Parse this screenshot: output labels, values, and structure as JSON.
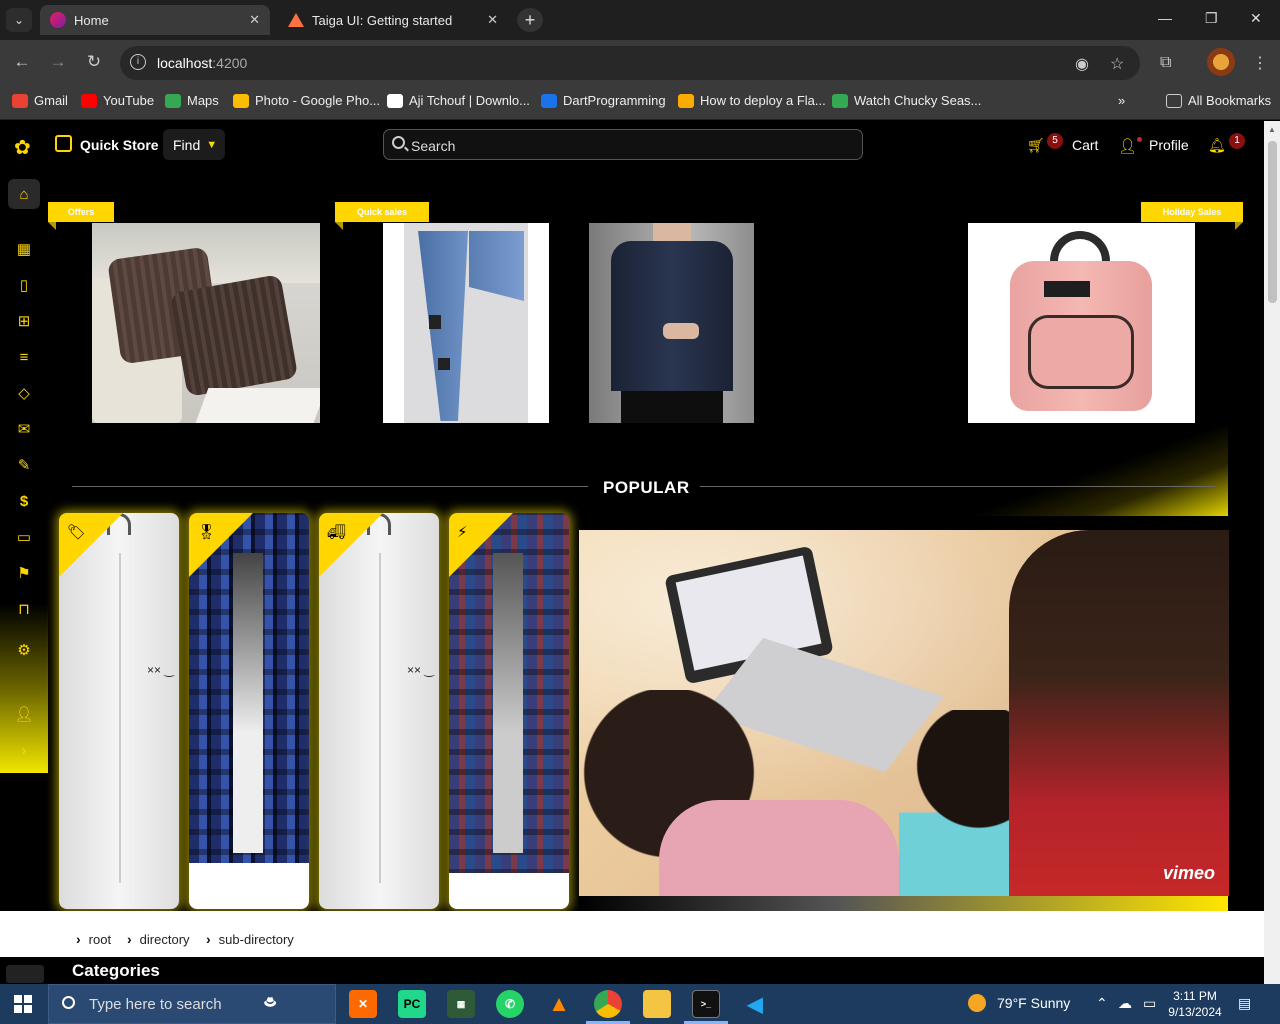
{
  "browser": {
    "tabs": [
      {
        "title": "Home",
        "active": true
      },
      {
        "title": "Taiga UI: Getting started",
        "active": false
      }
    ],
    "url_host": "localhost",
    "url_port": ":4200",
    "bookmarks": [
      {
        "label": "Gmail",
        "color": "#ea4335"
      },
      {
        "label": "YouTube",
        "color": "#ff0000"
      },
      {
        "label": "Maps",
        "color": "#34a853"
      },
      {
        "label": "Photo - Google Pho...",
        "color": "#fbbc04"
      },
      {
        "label": "Aji Tchouf | Downlo...",
        "color": "#ffffff"
      },
      {
        "label": "DartProgramming",
        "color": "#1a73e8"
      },
      {
        "label": "How to deploy a Fla...",
        "color": "#f9ab00"
      },
      {
        "label": "Watch Chucky Seas...",
        "color": "#34a853"
      }
    ],
    "all_bookmarks": "All Bookmarks"
  },
  "header": {
    "store_name": "Quick Store",
    "find_label": "Find",
    "search_placeholder": "Search",
    "cart_label": "Cart",
    "cart_count": "5",
    "profile_label": "Profile",
    "notification_count": "1",
    "accent": "#ffd600"
  },
  "sidebar": {
    "items": [
      "home-icon",
      "grid-icon",
      "clipboard-icon",
      "gift-icon",
      "sliders-icon",
      "tag-icon",
      "mail-icon",
      "pen-icon",
      "dollar-icon",
      "card-icon",
      "flag-icon",
      "bookmark-icon",
      "settings-icon",
      "add-user-icon",
      "chevron-right-icon"
    ]
  },
  "promos": [
    {
      "ribbon": "Offers"
    },
    {
      "ribbon": "Quick sales"
    },
    {
      "ribbon": "Holiday Sales"
    }
  ],
  "popular": {
    "title": "POPULAR",
    "cards": [
      {
        "corner_icon": "tags-icon"
      },
      {
        "corner_icon": "award-icon"
      },
      {
        "corner_icon": "truck-icon"
      },
      {
        "corner_icon": "bolt-icon"
      }
    ],
    "video_brand": "vimeo"
  },
  "breadcrumb": [
    "root",
    "directory",
    "sub-directory"
  ],
  "categories_title": "Categories",
  "taskbar": {
    "search_placeholder": "Type here to search",
    "weather": "79°F  Sunny",
    "time": "3:11 PM",
    "date": "9/13/2024"
  }
}
